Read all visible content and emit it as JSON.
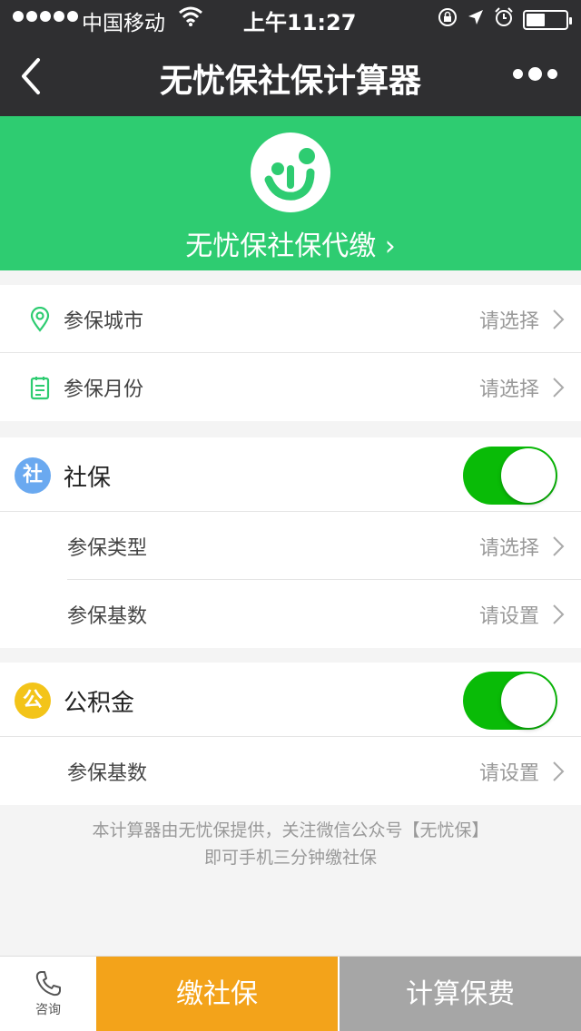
{
  "status_bar": {
    "carrier": "中国移动",
    "time": "上午11:27"
  },
  "nav": {
    "title": "无忧保社保计算器"
  },
  "banner": {
    "title": "无忧保社保代缴 ›"
  },
  "general": {
    "city_label": "参保城市",
    "city_value": "请选择",
    "month_label": "参保月份",
    "month_value": "请选择"
  },
  "social": {
    "badge": "社",
    "title": "社保",
    "toggle_on": true,
    "type_label": "参保类型",
    "type_value": "请选择",
    "base_label": "参保基数",
    "base_value": "请设置"
  },
  "fund": {
    "badge": "公",
    "title": "公积金",
    "toggle_on": true,
    "base_label": "参保基数",
    "base_value": "请设置"
  },
  "footnote": {
    "line1": "本计算器由无忧保提供，关注微信公众号【无忧保】",
    "line2": "即可手机三分钟缴社保"
  },
  "bottom": {
    "consult_label": "咨询",
    "pay_label": "缴社保",
    "calc_label": "计算保费"
  },
  "colors": {
    "brand_green": "#2ecc71",
    "toggle_green": "#09bb07",
    "pay_orange": "#f3a31a",
    "calc_gray": "#a6a6a6",
    "social_badge": "#6aa9f0",
    "fund_badge": "#f3c419"
  }
}
